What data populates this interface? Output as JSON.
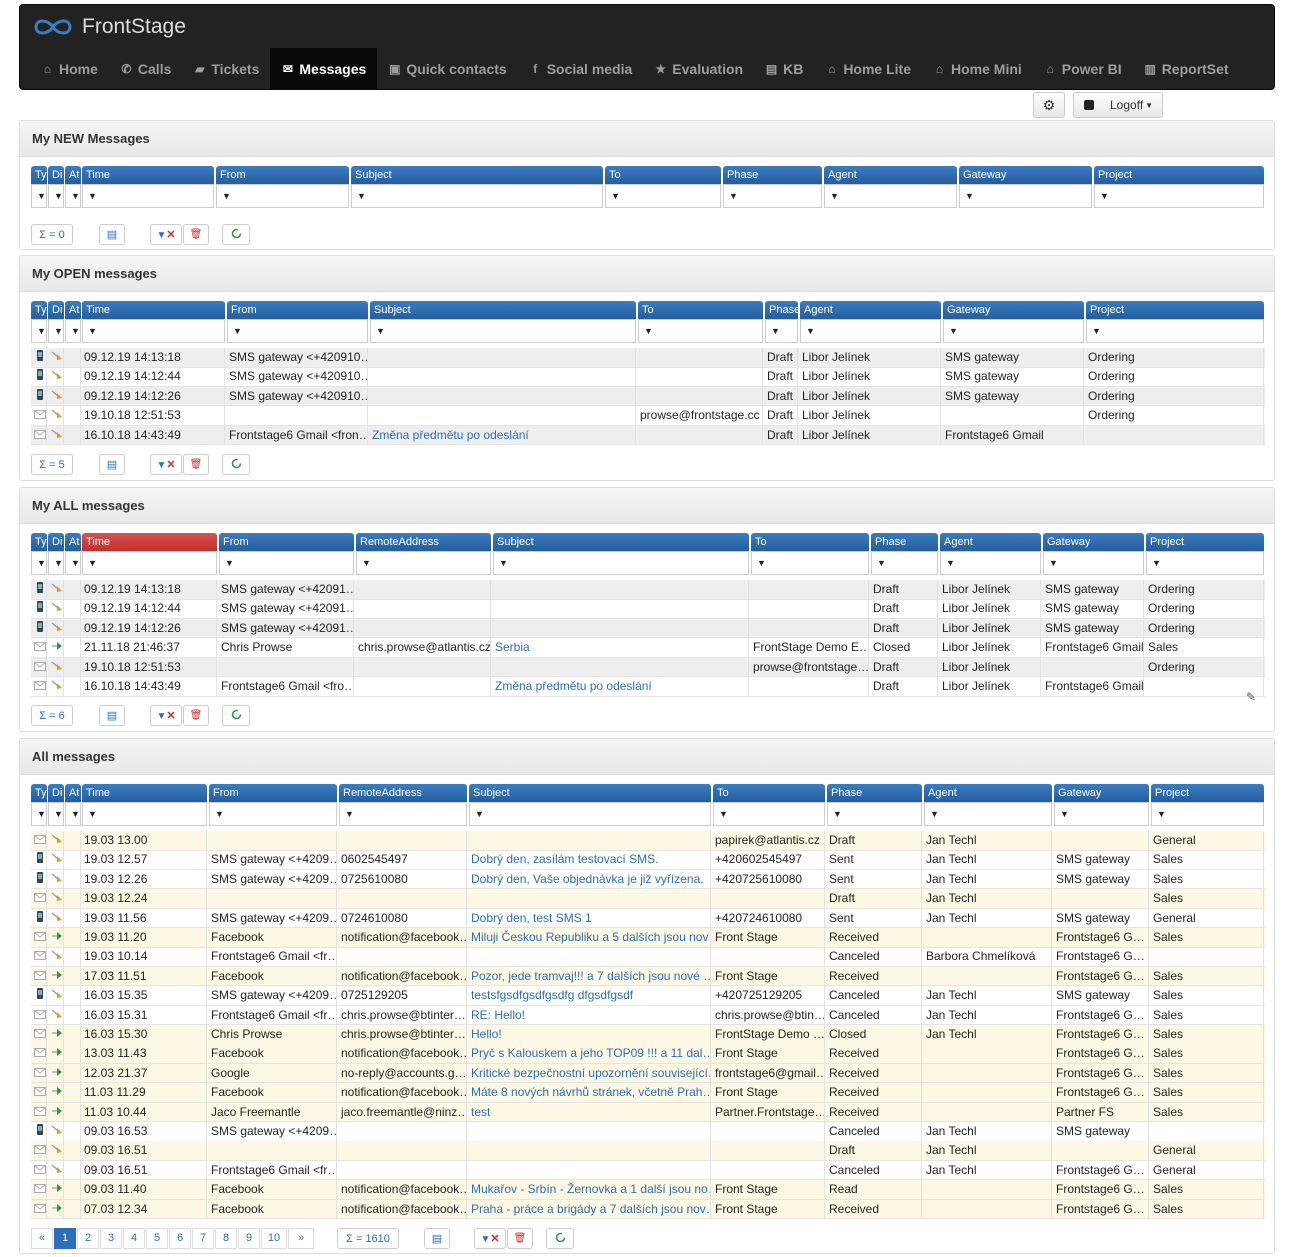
{
  "app": {
    "title": "FrontStage"
  },
  "nav": [
    {
      "label": "Home",
      "icon": "home-icon",
      "glyph": "⌂"
    },
    {
      "label": "Calls",
      "icon": "phone-icon",
      "glyph": "✆"
    },
    {
      "label": "Tickets",
      "icon": "briefcase-icon",
      "glyph": "▰"
    },
    {
      "label": "Messages",
      "icon": "envelope-icon",
      "glyph": "✉",
      "active": true
    },
    {
      "label": "Quick contacts",
      "icon": "contact-card-icon",
      "glyph": "▣"
    },
    {
      "label": "Social media",
      "icon": "facebook-icon",
      "glyph": "f"
    },
    {
      "label": "Evaluation",
      "icon": "star-icon",
      "glyph": "★"
    },
    {
      "label": "KB",
      "icon": "book-icon",
      "glyph": "▤"
    },
    {
      "label": "Home Lite",
      "icon": "home-icon",
      "glyph": "⌂"
    },
    {
      "label": "Home Mini",
      "icon": "home-icon",
      "glyph": "⌂"
    },
    {
      "label": "Power BI",
      "icon": "home-icon",
      "glyph": "⌂"
    },
    {
      "label": "ReportSet",
      "icon": "bar-chart-icon",
      "glyph": "▥"
    }
  ],
  "toolbar": {
    "logoff_label": "Logoff"
  },
  "colors": {
    "header_blue": "#2d6aad",
    "sorted_red": "#d9534f",
    "row_yellow": "#fcf8e3",
    "link": "#2a6ebd"
  },
  "panels": {
    "new": {
      "title": "My NEW Messages",
      "count": "Σ = 0",
      "columns": [
        "Ty",
        "Di",
        "At",
        "Time",
        "From",
        "Subject",
        "To",
        "Phase",
        "Agent",
        "Gateway",
        "Project"
      ],
      "rows": []
    },
    "open": {
      "title": "My OPEN messages",
      "count": "Σ = 5",
      "columns": [
        "Ty",
        "Di",
        "At",
        "Time",
        "From",
        "Subject",
        "To",
        "Phase",
        "Agent",
        "Gateway",
        "Project"
      ],
      "rows": [
        {
          "type": "sms",
          "dir": "out",
          "time": "09.12.19 14:13:18",
          "from": "SMS gateway <+420910…",
          "subject": "",
          "to": "",
          "phase": "Draft",
          "agent": "Libor Jelínek",
          "gateway": "SMS gateway",
          "project": "Ordering"
        },
        {
          "type": "sms",
          "dir": "out",
          "time": "09.12.19 14:12:44",
          "from": "SMS gateway <+420910…",
          "subject": "",
          "to": "",
          "phase": "Draft",
          "agent": "Libor Jelínek",
          "gateway": "SMS gateway",
          "project": "Ordering"
        },
        {
          "type": "sms",
          "dir": "out",
          "time": "09.12.19 14:12:26",
          "from": "SMS gateway <+420910…",
          "subject": "",
          "to": "",
          "phase": "Draft",
          "agent": "Libor Jelínek",
          "gateway": "SMS gateway",
          "project": "Ordering"
        },
        {
          "type": "mail",
          "dir": "out",
          "time": "19.10.18 12:51:53",
          "from": "",
          "subject": "",
          "to": "prowse@frontstage.cc",
          "phase": "Draft",
          "agent": "Libor Jelínek",
          "gateway": "",
          "project": "Ordering"
        },
        {
          "type": "mail",
          "dir": "out",
          "time": "16.10.18 14:43:49",
          "from": "Frontstage6 Gmail <fron…",
          "subject": "Změna předmětu po odeslání",
          "to": "",
          "phase": "Draft",
          "agent": "Libor Jelínek",
          "gateway": "Frontstage6 Gmail",
          "project": ""
        }
      ]
    },
    "all_mine": {
      "title": "My ALL messages",
      "count": "Σ = 6",
      "columns": [
        "Ty",
        "Di",
        "At",
        "Time",
        "From",
        "RemoteAddress",
        "Subject",
        "To",
        "Phase",
        "Agent",
        "Gateway",
        "Project"
      ],
      "rows": [
        {
          "type": "sms",
          "dir": "out",
          "time": "09.12.19 14:13:18",
          "from": "SMS gateway <+42091…",
          "remote": "",
          "subject": "",
          "to": "",
          "phase": "Draft",
          "agent": "Libor Jelínek",
          "gateway": "SMS gateway",
          "project": "Ordering"
        },
        {
          "type": "sms",
          "dir": "out",
          "time": "09.12.19 14:12:44",
          "from": "SMS gateway <+42091…",
          "remote": "",
          "subject": "",
          "to": "",
          "phase": "Draft",
          "agent": "Libor Jelínek",
          "gateway": "SMS gateway",
          "project": "Ordering"
        },
        {
          "type": "sms",
          "dir": "out",
          "time": "09.12.19 14:12:26",
          "from": "SMS gateway <+42091…",
          "remote": "",
          "subject": "",
          "to": "",
          "phase": "Draft",
          "agent": "Libor Jelínek",
          "gateway": "SMS gateway",
          "project": "Ordering"
        },
        {
          "type": "mail",
          "dir": "in",
          "time": "21.11.18 21:46:37",
          "from": "Chris Prowse",
          "remote": "chris.prowse@atlantis.cz",
          "subject": "Serbia",
          "to": "FrontStage Demo E…",
          "phase": "Closed",
          "agent": "Libor Jelínek",
          "gateway": "Frontstage6 Gmail",
          "project": "Sales"
        },
        {
          "type": "mail",
          "dir": "out",
          "time": "19.10.18 12:51:53",
          "from": "",
          "remote": "",
          "subject": "",
          "to": "prowse@frontstage…",
          "phase": "Draft",
          "agent": "Libor Jelínek",
          "gateway": "",
          "project": "Ordering"
        },
        {
          "type": "mail",
          "dir": "out",
          "time": "16.10.18 14:43:49",
          "from": "Frontstage6 Gmail <fro…",
          "remote": "",
          "subject": "Změna předmětu po odeslání",
          "to": "",
          "phase": "Draft",
          "agent": "Libor Jelínek",
          "gateway": "Frontstage6 Gmail",
          "project": ""
        }
      ]
    },
    "all": {
      "title": "All messages",
      "count": "Σ = 1610",
      "columns": [
        "Ty",
        "Di",
        "At",
        "Time",
        "From",
        "RemoteAddress",
        "Subject",
        "To",
        "Phase",
        "Agent",
        "Gateway",
        "Project"
      ],
      "pages": [
        "«",
        "1",
        "2",
        "3",
        "4",
        "5",
        "6",
        "7",
        "8",
        "9",
        "10",
        "»"
      ],
      "rows": [
        {
          "type": "mail",
          "dir": "out",
          "time": "19.03 13.00",
          "from": "",
          "remote": "",
          "subject": "",
          "to": "papirek@atlantis.cz",
          "phase": "Draft",
          "agent": "Jan Techl",
          "gateway": "",
          "project": "General"
        },
        {
          "type": "sms",
          "dir": "out",
          "time": "19.03 12.57",
          "from": "SMS gateway <+4209…",
          "remote": "0602545497",
          "subject": "Dobrý den, zasílám testovací SMS.",
          "to": "+420602545497",
          "phase": "Sent",
          "agent": "Jan Techl",
          "gateway": "SMS gateway",
          "project": "Sales"
        },
        {
          "type": "sms",
          "dir": "out",
          "time": "19.03 12.26",
          "from": "SMS gateway <+4209…",
          "remote": "0725610080",
          "subject": "Dobrý den, Vaše objednávka je již vyřízena.",
          "to": "+420725610080",
          "phase": "Sent",
          "agent": "Jan Techl",
          "gateway": "SMS gateway",
          "project": "Sales"
        },
        {
          "type": "mail",
          "dir": "out",
          "time": "19.03 12.24",
          "from": "",
          "remote": "",
          "subject": "",
          "to": "",
          "phase": "Draft",
          "agent": "Jan Techl",
          "gateway": "",
          "project": "Sales"
        },
        {
          "type": "sms",
          "dir": "out",
          "time": "19.03 11.56",
          "from": "SMS gateway <+4209…",
          "remote": "0724610080",
          "subject": "Dobrý den, test SMS 1",
          "to": "+420724610080",
          "phase": "Sent",
          "agent": "Jan Techl",
          "gateway": "SMS gateway",
          "project": "General"
        },
        {
          "type": "mail",
          "dir": "in",
          "time": "19.03 11.20",
          "from": "Facebook",
          "remote": "notification@facebook…",
          "subject": "Miluji Českou Republiku a 5 dalších jsou nov…",
          "to": "Front Stage",
          "phase": "Received",
          "agent": "",
          "gateway": "Frontstage6 G…",
          "project": "Sales"
        },
        {
          "type": "mail",
          "dir": "out",
          "time": "19.03 10.14",
          "from": "Frontstage6 Gmail <fr…",
          "remote": "",
          "subject": "",
          "to": "",
          "phase": "Canceled",
          "agent": "Barbora Chmelíková",
          "gateway": "Frontstage6 G…",
          "project": ""
        },
        {
          "type": "mail",
          "dir": "in",
          "time": "17.03 11.51",
          "from": "Facebook",
          "remote": "notification@facebook…",
          "subject": "Pozor, jede tramvaj!!! a 7 dalších jsou nové …",
          "to": "Front Stage",
          "phase": "Received",
          "agent": "",
          "gateway": "Frontstage6 G…",
          "project": "Sales"
        },
        {
          "type": "sms",
          "dir": "out",
          "time": "16.03 15.35",
          "from": "SMS gateway <+4209…",
          "remote": "0725129205",
          "subject": "testsfgsdfgsdfgsdfg dfgsdfgsdf",
          "to": "+420725129205",
          "phase": "Canceled",
          "agent": "Jan Techl",
          "gateway": "SMS gateway",
          "project": "Sales"
        },
        {
          "type": "mail",
          "dir": "out",
          "time": "16.03 15.31",
          "from": "Frontstage6 Gmail <fr…",
          "remote": "chris.prowse@btinter…",
          "subject": "RE: Hello!",
          "to": "chris.prowse@btin…",
          "phase": "Canceled",
          "agent": "Jan Techl",
          "gateway": "Frontstage6 G…",
          "project": "Sales"
        },
        {
          "type": "mail",
          "dir": "in",
          "time": "16.03 15.30",
          "from": "Chris Prowse",
          "remote": "chris.prowse@btinter…",
          "subject": "Hello!",
          "to": "FrontStage Demo …",
          "phase": "Closed",
          "agent": "Jan Techl",
          "gateway": "Frontstage6 G…",
          "project": "Sales"
        },
        {
          "type": "mail",
          "dir": "in",
          "time": "13.03 11.43",
          "from": "Facebook",
          "remote": "notification@facebook…",
          "subject": "Pryč s Kalouskem a jeho TOP09 !!! a 11 dal…",
          "to": "Front Stage",
          "phase": "Received",
          "agent": "",
          "gateway": "Frontstage6 G…",
          "project": "Sales"
        },
        {
          "type": "mail",
          "dir": "in",
          "time": "12.03 21.37",
          "from": "Google",
          "remote": "no-reply@accounts.g…",
          "subject": "Kritické bezpečnostní upozornění související…",
          "to": "frontstage6@gmail…",
          "phase": "Received",
          "agent": "",
          "gateway": "Frontstage6 G…",
          "project": "Sales"
        },
        {
          "type": "mail",
          "dir": "in",
          "time": "11.03 11.29",
          "from": "Facebook",
          "remote": "notification@facebook…",
          "subject": "Máte 8 nových návrhů stránek, včetně Prah…",
          "to": "Front Stage",
          "phase": "Received",
          "agent": "",
          "gateway": "Frontstage6 G…",
          "project": "Sales"
        },
        {
          "type": "mail",
          "dir": "in",
          "time": "11.03 10.44",
          "from": "Jaco Freemantle",
          "remote": "jaco.freemantle@ninz…",
          "subject": "test",
          "to": "Partner.Frontstage…",
          "phase": "Received",
          "agent": "",
          "gateway": "Partner FS",
          "project": "Sales"
        },
        {
          "type": "sms",
          "dir": "out",
          "time": "09.03 16.53",
          "from": "SMS gateway <+4209…",
          "remote": "",
          "subject": "",
          "to": "",
          "phase": "Canceled",
          "agent": "Jan Techl",
          "gateway": "SMS gateway",
          "project": ""
        },
        {
          "type": "mail",
          "dir": "out",
          "time": "09.03 16.51",
          "from": "",
          "remote": "",
          "subject": "",
          "to": "",
          "phase": "Draft",
          "agent": "Jan Techl",
          "gateway": "",
          "project": "General"
        },
        {
          "type": "mail",
          "dir": "out",
          "time": "09.03 16.51",
          "from": "Frontstage6 Gmail <fr…",
          "remote": "",
          "subject": "",
          "to": "",
          "phase": "Canceled",
          "agent": "Jan Techl",
          "gateway": "Frontstage6 G…",
          "project": "General"
        },
        {
          "type": "mail",
          "dir": "in",
          "time": "09.03 11.40",
          "from": "Facebook",
          "remote": "notification@facebook…",
          "subject": "Mukařov - Srbín - Žernovka a 1 další jsou no…",
          "to": "Front Stage",
          "phase": "Read",
          "agent": "",
          "gateway": "Frontstage6 G…",
          "project": "Sales"
        },
        {
          "type": "mail",
          "dir": "in",
          "time": "07.03 12.34",
          "from": "Facebook",
          "remote": "notification@facebook…",
          "subject": "Praha - práce a brigády a 7 dalších jsou nov…",
          "to": "Front Stage",
          "phase": "Received",
          "agent": "",
          "gateway": "Frontstage6 G…",
          "project": "Sales"
        }
      ]
    }
  }
}
